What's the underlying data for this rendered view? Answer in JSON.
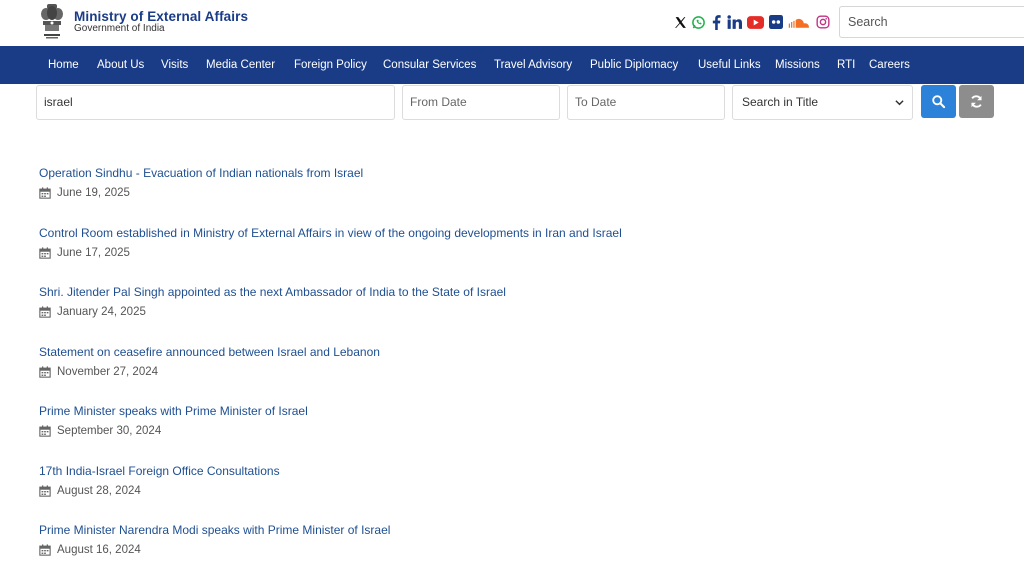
{
  "header": {
    "title": "Ministry of External Affairs",
    "subtitle": "Government of India",
    "search_placeholder": "Search",
    "social_icons": [
      "x-icon",
      "whatsapp-icon",
      "facebook-icon",
      "linkedin-icon",
      "youtube-icon",
      "flickr-icon",
      "soundcloud-icon",
      "instagram-icon"
    ]
  },
  "nav": {
    "items": [
      "Home",
      "About Us",
      "Visits",
      "Media Center",
      "Foreign Policy",
      "Consular Services",
      "Travel Advisory",
      "Public Diplomacy",
      "Useful Links",
      "Missions",
      "RTI",
      "Careers"
    ]
  },
  "filters": {
    "keyword": "israel",
    "from_date_placeholder": "From Date",
    "to_date_placeholder": "To Date",
    "search_in": "Search in Title"
  },
  "results": [
    {
      "title": "Operation Sindhu - Evacuation of Indian nationals from Israel",
      "date": "June 19, 2025"
    },
    {
      "title": "Control Room established in Ministry of External Affairs in view of the ongoing developments in Iran and Israel",
      "date": "June 17, 2025"
    },
    {
      "title": "Shri. Jitender Pal Singh appointed as the next Ambassador of India to the State of Israel",
      "date": "January 24, 2025"
    },
    {
      "title": "Statement on ceasefire announced between Israel and Lebanon",
      "date": "November 27, 2024"
    },
    {
      "title": "Prime Minister speaks with Prime Minister of Israel",
      "date": "September 30, 2024"
    },
    {
      "title": "17th India-Israel Foreign Office Consultations",
      "date": "August 28, 2024"
    },
    {
      "title": "Prime Minister Narendra Modi speaks with Prime Minister of Israel",
      "date": "August 16, 2024"
    }
  ],
  "colors": {
    "nav_bg": "#1a3c86",
    "link": "#1f4f91",
    "search_btn": "#2c82d8",
    "reset_btn": "#8d8d8d"
  }
}
